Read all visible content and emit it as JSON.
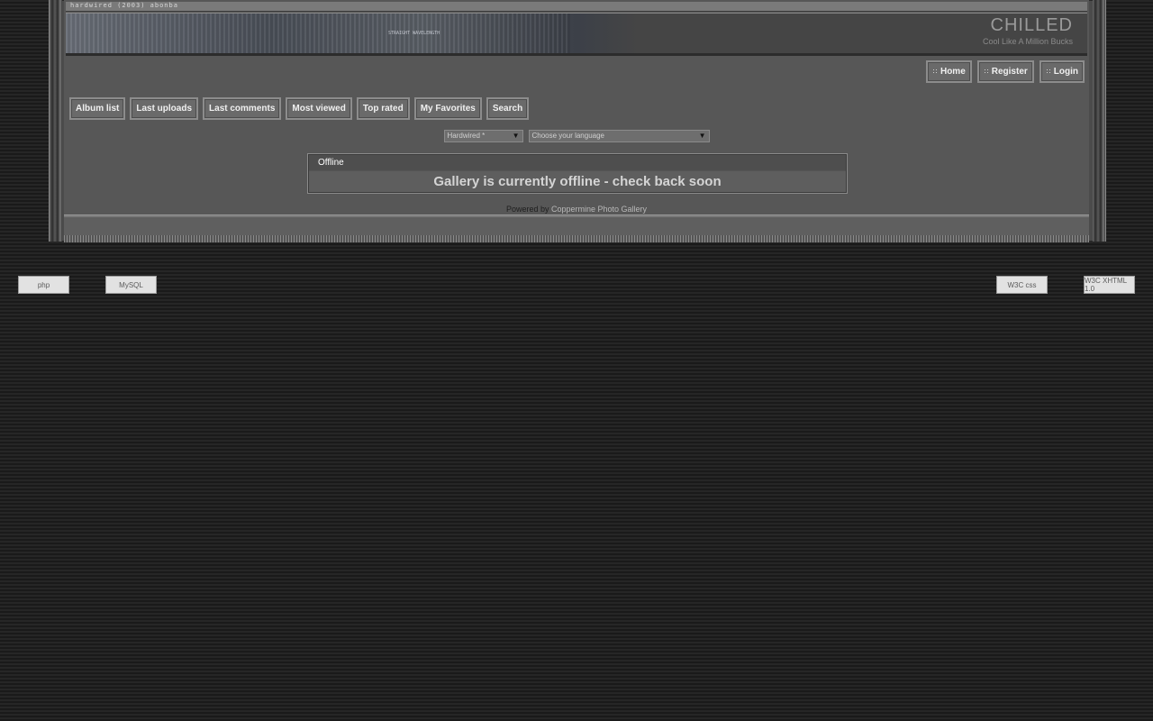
{
  "header": {
    "top_strip_text": "hardwired (2003) abonba",
    "banner_micro_text": "STRAIGHT WAVELENGTH",
    "site_title": "CHILLED",
    "site_description": "Cool Like A Million Bucks"
  },
  "top_nav": [
    {
      "label": "Home",
      "icon": "dots-icon"
    },
    {
      "label": "Register",
      "icon": "dots-icon"
    },
    {
      "label": "Login",
      "icon": "dots-icon"
    }
  ],
  "main_nav": [
    "Album list",
    "Last uploads",
    "Last comments",
    "Most viewed",
    "Top rated",
    "My Favorites",
    "Search"
  ],
  "selectors": {
    "theme": {
      "value": "Hardwired *"
    },
    "language": {
      "value": "Choose your language"
    }
  },
  "offline": {
    "title": "Offline",
    "message": "Gallery is currently offline - check back soon"
  },
  "footer": {
    "powered_prefix": "Powered by",
    "powered_link": "Coppermine Photo Gallery"
  },
  "badges": {
    "php": "php",
    "mysql": "MySQL",
    "css": "W3C css",
    "xhtml": "W3C XHTML 1.0"
  },
  "colors": {
    "page_background": "#1e1e1e",
    "panel": "#575757",
    "button": "#6a6a6a",
    "message_text": "#d4d4d4"
  }
}
